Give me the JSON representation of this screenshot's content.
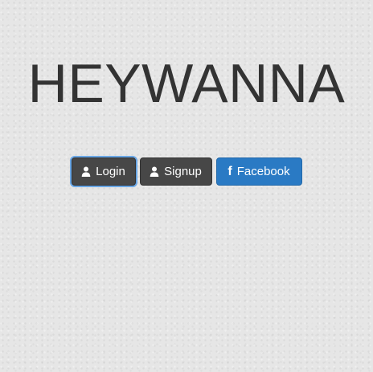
{
  "brand": {
    "title": "HEYWANNA"
  },
  "buttons": {
    "login": {
      "label": "Login",
      "icon": "user-icon"
    },
    "signup": {
      "label": "Signup",
      "icon": "user-icon"
    },
    "facebook": {
      "label": "Facebook",
      "icon": "facebook-icon"
    }
  },
  "colors": {
    "text": "#333333",
    "button_dark": "#474747",
    "facebook_blue": "#2a7ac4",
    "focus_ring": "#6aa7e6"
  }
}
